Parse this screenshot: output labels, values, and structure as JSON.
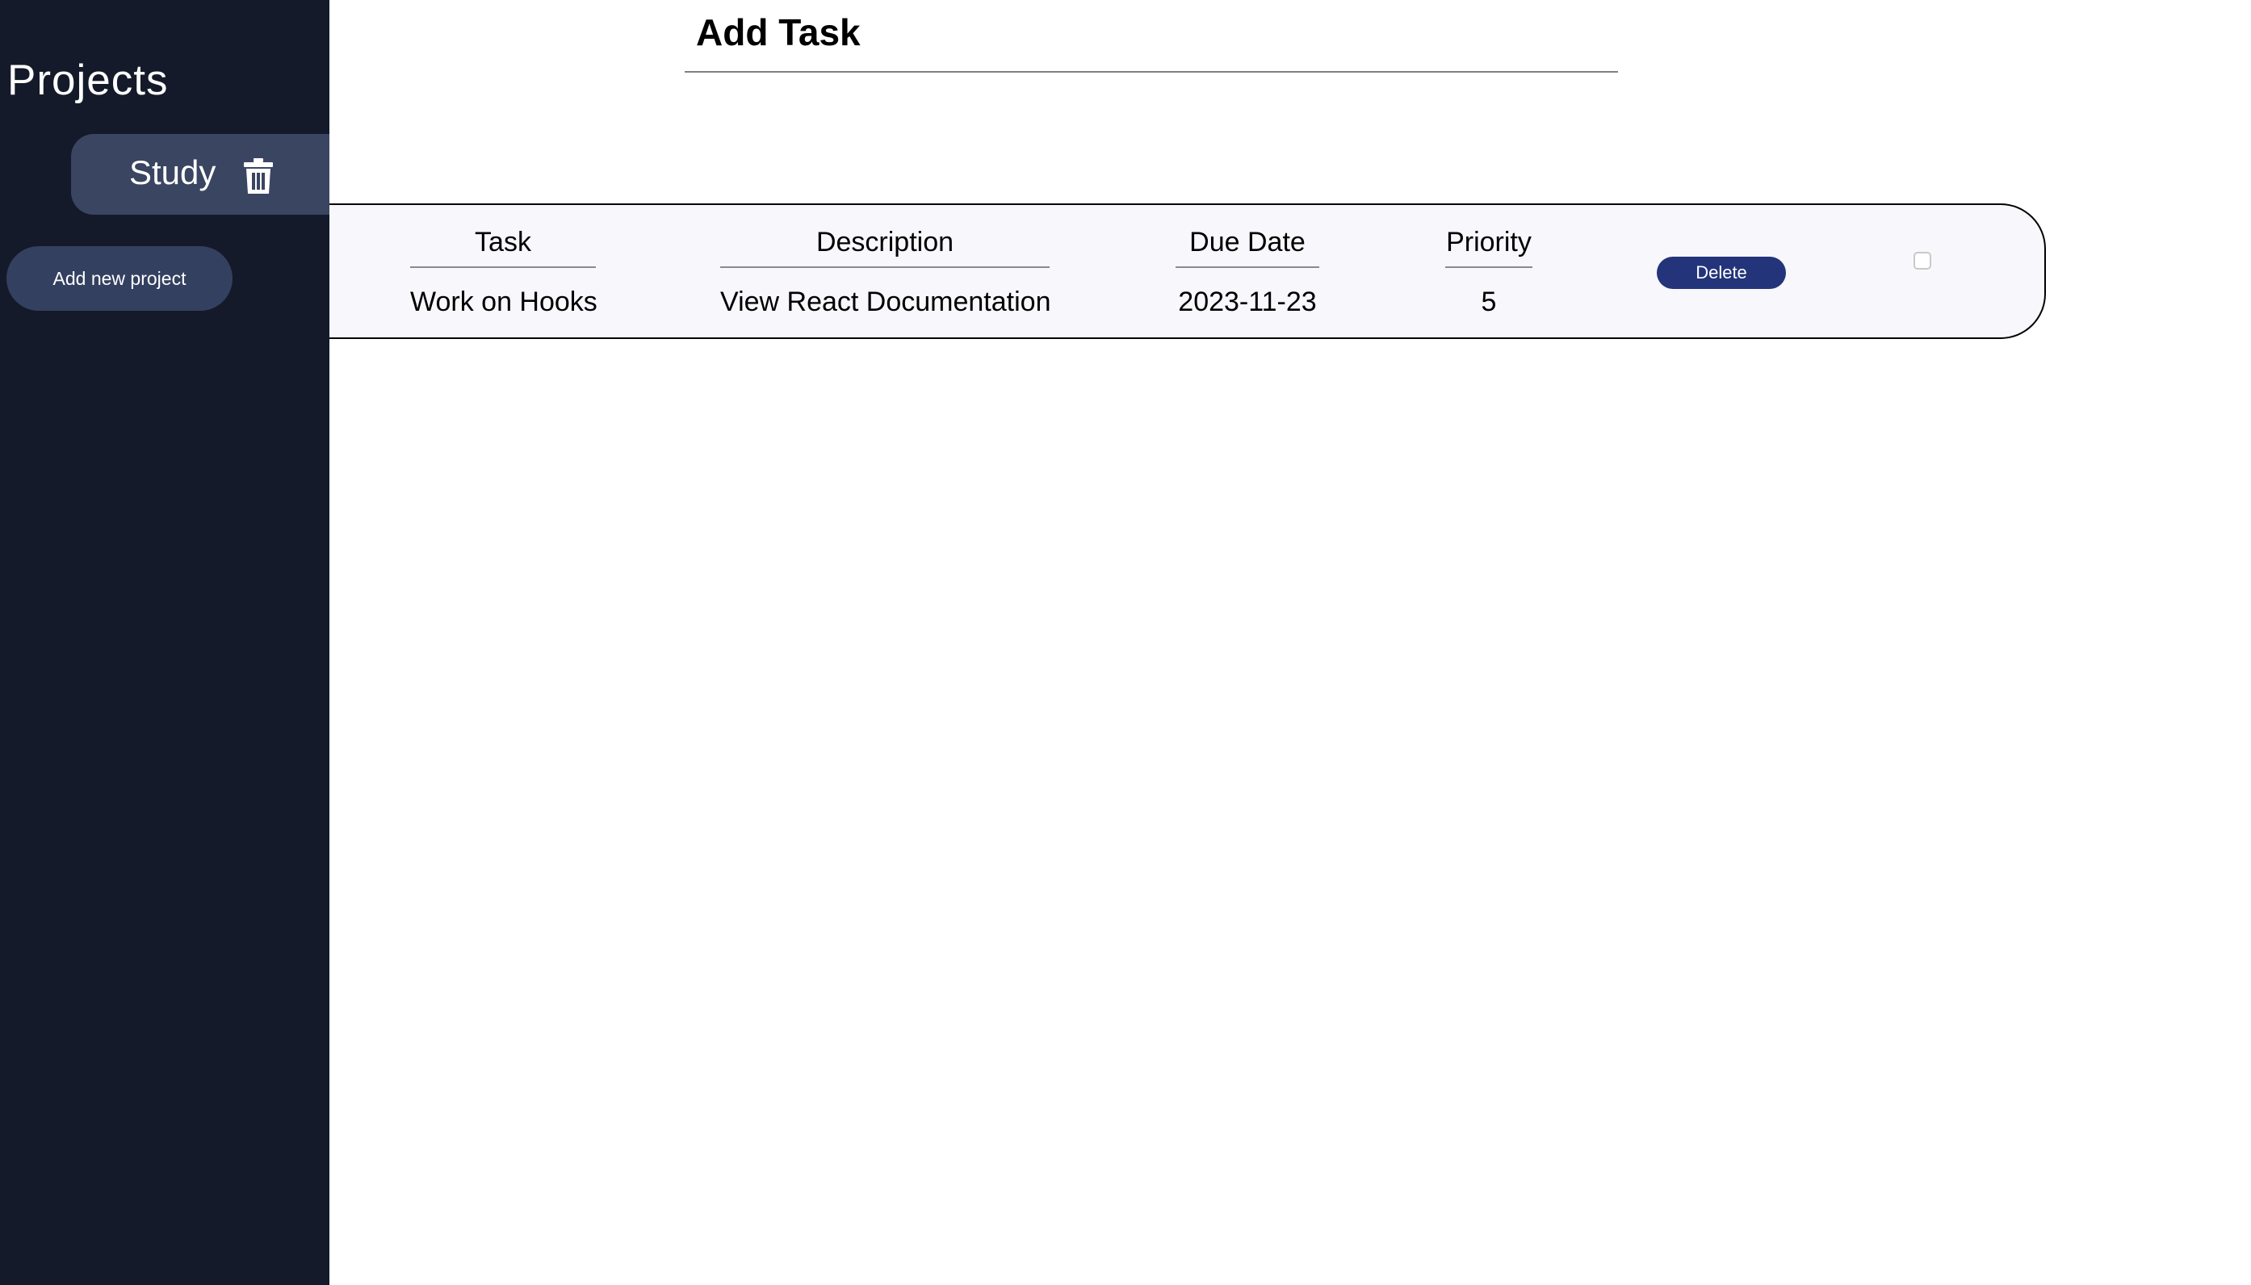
{
  "sidebar": {
    "title": "Projects",
    "projects": [
      {
        "label": "Study",
        "icon": "trash-icon"
      }
    ],
    "add_project_label": "Add new project"
  },
  "main": {
    "add_task_label": "Add Task",
    "table": {
      "headers": {
        "task": "Task",
        "description": "Description",
        "due_date": "Due Date",
        "priority": "Priority"
      },
      "rows": [
        {
          "task": "Work on Hooks",
          "description": "View React Documentation",
          "due_date": "2023-11-23",
          "priority": "5",
          "delete_label": "Delete",
          "completed": false
        }
      ]
    }
  },
  "colors": {
    "sidebar_bg": "#141a29",
    "project_item_bg": "#3a4562",
    "add_project_bg": "#344060",
    "delete_button_bg": "#23347a",
    "table_bg": "#f7f7fc"
  }
}
